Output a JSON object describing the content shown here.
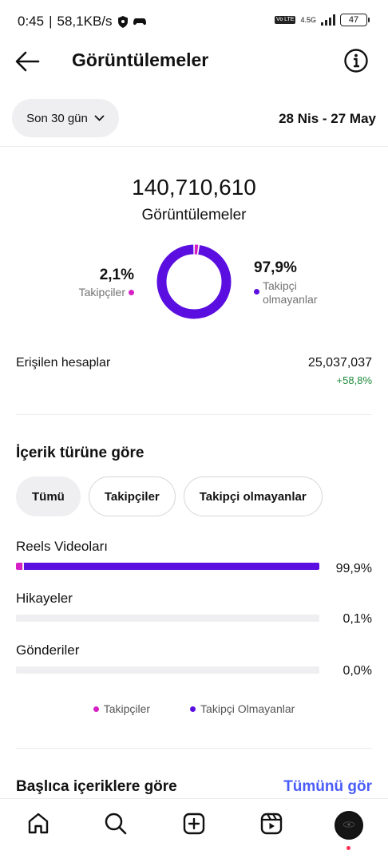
{
  "status_bar": {
    "time": "0:45",
    "speed": "58,1KB/s",
    "network": "4.5G",
    "volte": "Vo LTE",
    "battery": "47"
  },
  "header": {
    "title": "Görüntülemeler"
  },
  "period": {
    "selector_label": "Son 30 gün",
    "date_range": "28 Nis - 27 May"
  },
  "summary": {
    "total_views": "140,710,610",
    "total_label": "Görüntülemeler",
    "followers_pct": "2,1%",
    "followers_label": "Takipçiler",
    "non_followers_pct": "97,9%",
    "non_followers_label_line1": "Takipçi",
    "non_followers_label_line2": "olmayanlar",
    "followers_fraction": 0.021
  },
  "reach": {
    "label": "Erişilen hesaplar",
    "value": "25,037,037",
    "change": "+58,8%"
  },
  "content_type": {
    "title": "İçerik türüne göre",
    "filters": [
      "Tümü",
      "Takipçiler",
      "Takipçi olmayanlar"
    ],
    "rows": [
      {
        "name": "Reels Videoları",
        "pct": "99,9%",
        "followers_fraction": 0.02,
        "non_followers_fraction": 0.979
      },
      {
        "name": "Hikayeler",
        "pct": "0,1%",
        "followers_fraction": 0.0,
        "non_followers_fraction": 0.0
      },
      {
        "name": "Gönderiler",
        "pct": "0,0%",
        "followers_fraction": 0.0,
        "non_followers_fraction": 0.0
      }
    ],
    "legend_followers": "Takipçiler",
    "legend_non_followers": "Takipçi Olmayanlar"
  },
  "top_content": {
    "title": "Başlıca içeriklere göre",
    "see_all": "Tümünü gör"
  },
  "colors": {
    "followers": "#d620c5",
    "non_followers": "#5b0ee0",
    "accent_link": "#4a5df9",
    "positive": "#1f8a3a"
  },
  "icons": {
    "back": "arrow-left-icon",
    "info": "info-icon",
    "nav": [
      "home-icon",
      "search-icon",
      "create-icon",
      "reels-icon",
      "profile-avatar"
    ]
  }
}
